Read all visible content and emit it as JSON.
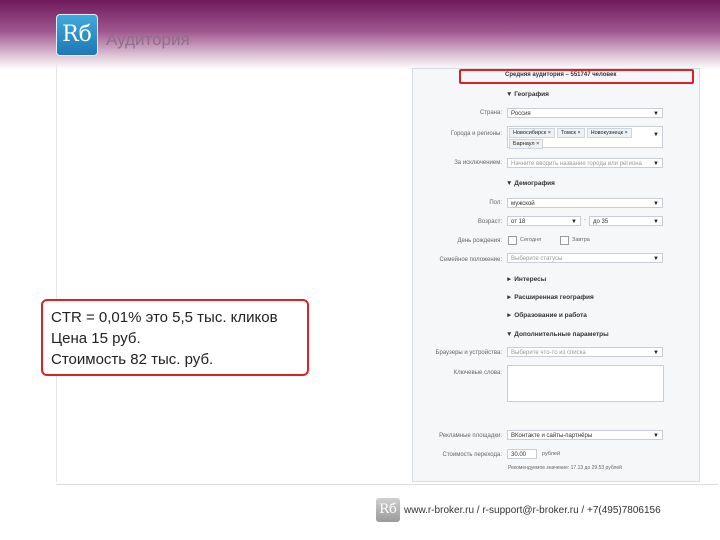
{
  "header": {
    "logo_text": "Rб",
    "title": "Аудитория"
  },
  "form": {
    "audience_text": "Средняя аудитория – 551747 человек",
    "sections": {
      "geography": "▼ География",
      "demography": "▼ Демография",
      "interests": "► Интересы",
      "ext_geography": "► Расширенная география",
      "education": "► Образование и работа",
      "additional": "▼ Дополнительные параметры"
    },
    "labels": {
      "country": "Страна:",
      "cities": "Города и регионы:",
      "except": "За исключением:",
      "sex": "Пол:",
      "age": "Возраст:",
      "birthday": "День рождения:",
      "family": "Семейное положение:",
      "browsers": "Браузеры и устройства:",
      "keywords": "Ключевые слова:",
      "platforms": "Рекламные площадки:",
      "cost": "Стоимость перехода:"
    },
    "values": {
      "country": "Россия",
      "cities": [
        "Новосибирск",
        "Томск",
        "Новокузнецк",
        "Барнаул"
      ],
      "except_placeholder": "Начните вводить название города или региона",
      "sex": "мужской",
      "age_from": "от 18",
      "age_to": "до 35",
      "age_dash": "-",
      "birthday_today": "Сегодня",
      "birthday_tomorrow": "Завтра",
      "family_placeholder": "Выберите статусы",
      "browsers_placeholder": "Выберите что-то из списка",
      "platforms": "ВКонтакте и сайты-партнёры",
      "cost": "30.00",
      "cost_unit": "рублей",
      "recommended": "Рекомендуемое значение: 17.13 до 29.53 рублей"
    }
  },
  "callout": {
    "line1": "CTR = 0,01%  это 5,5 тыс. кликов",
    "line2": "Цена 15 руб.",
    "line3": "Стоимость 82 тыс. руб."
  },
  "footer": {
    "logo_text": "Rб",
    "contacts": "www.r-broker.ru / r-support@r-broker.ru / +7(495)7806156"
  }
}
